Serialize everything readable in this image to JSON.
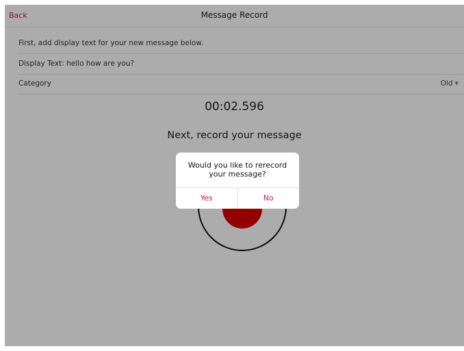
{
  "navbar": {
    "back_label": "Back",
    "title": "Message Record"
  },
  "form": {
    "instruction_text": "First, add display text for your new message below.",
    "display_text_label": "Display Text: hello how are you?",
    "category_label": "Category",
    "category_value": "Old",
    "category_caret": "▼"
  },
  "recorder": {
    "timer": "00:02.596",
    "instruction": "Next, record your message"
  },
  "dialog": {
    "message": "Would you like to rerecord your message?",
    "yes_label": "Yes",
    "no_label": "No"
  },
  "colors": {
    "accent": "#c2185b",
    "record": "#d50000"
  }
}
